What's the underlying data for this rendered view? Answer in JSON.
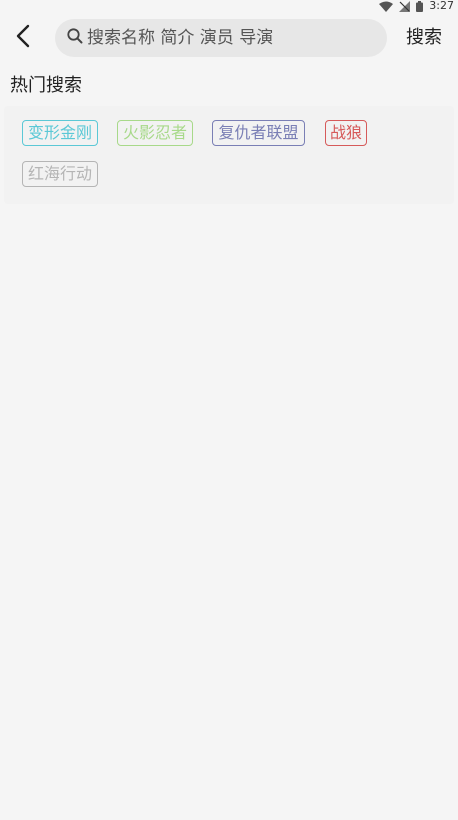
{
  "status_bar": {
    "time": "3:27",
    "icons": [
      "wifi-icon",
      "signal-icon",
      "battery-icon"
    ]
  },
  "header": {
    "back_icon": "chevron-left-icon",
    "search": {
      "icon": "search-icon",
      "placeholder": "搜索名称 简介 演员 导演",
      "value": ""
    },
    "search_label": "搜索"
  },
  "hot": {
    "title": "热门搜索",
    "tags": [
      {
        "label": "变形金刚",
        "color": "#5bc8d6"
      },
      {
        "label": "火影忍者",
        "color": "#a8d98a"
      },
      {
        "label": "复仇者联盟",
        "color": "#7a7fb5"
      },
      {
        "label": "战狼",
        "color": "#d65a5a"
      },
      {
        "label": "红海行动",
        "color": "#b5b5b5"
      }
    ]
  }
}
